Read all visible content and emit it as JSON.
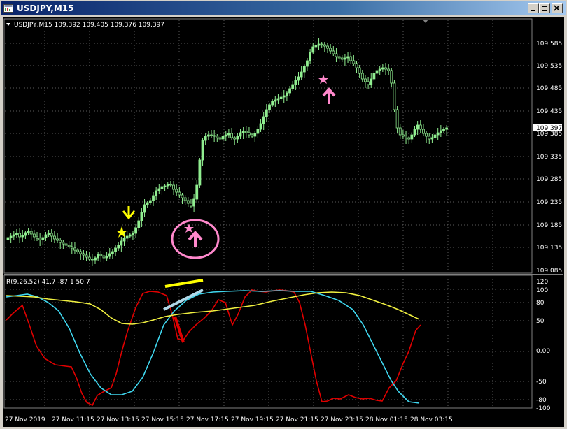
{
  "window": {
    "title": "USDJPY,M15"
  },
  "colors": {
    "bull": "#90ee90",
    "bear": "#000000",
    "grid": "#5a5a5a",
    "pct_r": "#e00000",
    "pct_r_cyan": "#40d8f0",
    "pct_r_yellow": "#f0f040",
    "pink": "#ff88cc",
    "yellow_marker": "#ffff00",
    "light_blue": "#b0d8e8"
  },
  "price_panel": {
    "header": "USDJPY,M15  109.392 109.405 109.376 109.397",
    "y_ticks": [
      "109.585",
      "109.535",
      "109.485",
      "109.435",
      "109.385",
      "109.335",
      "109.285",
      "109.235",
      "109.185",
      "109.135",
      "109.085"
    ],
    "current_price": "109.397"
  },
  "indicator_panel": {
    "header": "R(9,26,52) 41.7 -87.1 50.7",
    "y_ticks": [
      "120",
      "100",
      "80",
      "50",
      "0.00",
      "-50",
      "-80",
      "-100"
    ]
  },
  "time_axis": [
    "27 Nov 2019",
    "27 Nov 11:15",
    "27 Nov 13:15",
    "27 Nov 15:15",
    "27 Nov 17:15",
    "27 Nov 19:15",
    "27 Nov 21:15",
    "27 Nov 23:15",
    "28 Nov 01:15",
    "28 Nov 03:15"
  ],
  "icons": [
    "app-icon",
    "minimize-icon",
    "restore-icon",
    "close-icon",
    "collapse-arrow-icon",
    "scroll-arrow-icon"
  ]
}
